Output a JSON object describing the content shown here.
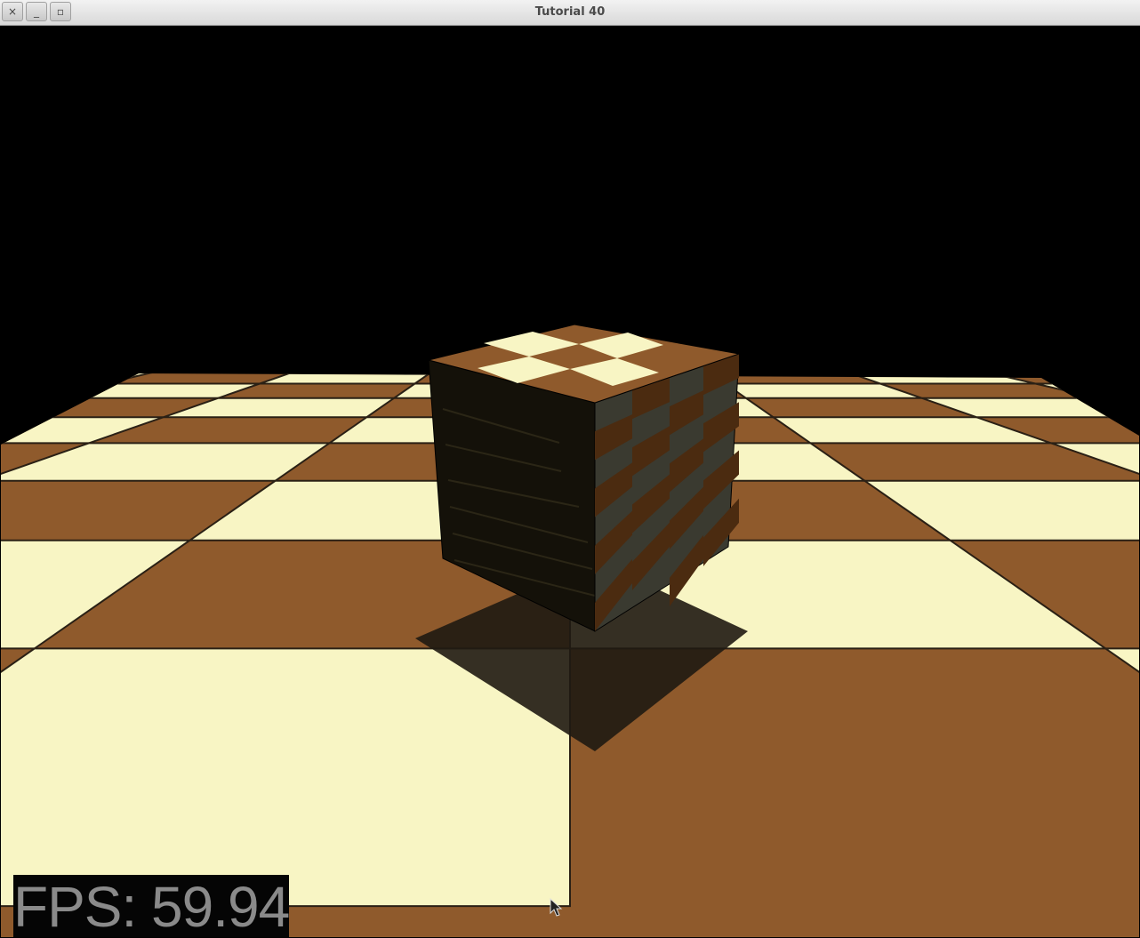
{
  "window": {
    "title": "Tutorial 40",
    "buttons": {
      "close": "×",
      "minimize": "_",
      "maximize": "▫"
    }
  },
  "viewport": {
    "background": "#000000",
    "floor_dark": "#8f5a2c",
    "floor_light": "#f8f5c4",
    "fps_text": "FPS: 59.94"
  }
}
